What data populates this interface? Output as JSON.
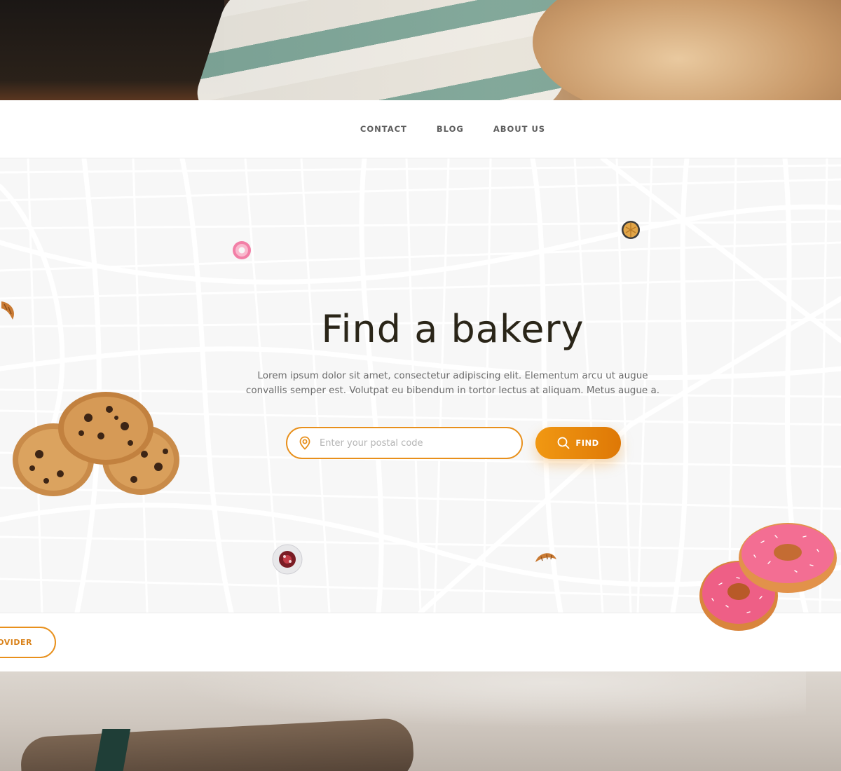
{
  "nav": {
    "links": [
      {
        "label": "CONTACT"
      },
      {
        "label": "BLOG"
      },
      {
        "label": "ABOUT US"
      }
    ]
  },
  "hero": {
    "title": "Find a bakery",
    "description": "Lorem ipsum dolor sit amet, consectetur adipiscing elit. Elementum arcu ut augue convallis semper est. Volutpat eu bibendum in tortor lectus at aliquam. Metus augue a.",
    "search": {
      "placeholder": "Enter your postal code",
      "icon": "location-pin-icon"
    },
    "find_button": {
      "label": "FIND",
      "icon": "search-icon"
    }
  },
  "footer": {
    "provider_button_label": "OVIDER"
  },
  "colors": {
    "accent": "#e8901c",
    "accent_dark": "#de7806",
    "title": "#2a2518",
    "body_text": "#6b6b6b",
    "map_bg": "#f7f7f7",
    "map_roads": "#ffffff"
  }
}
